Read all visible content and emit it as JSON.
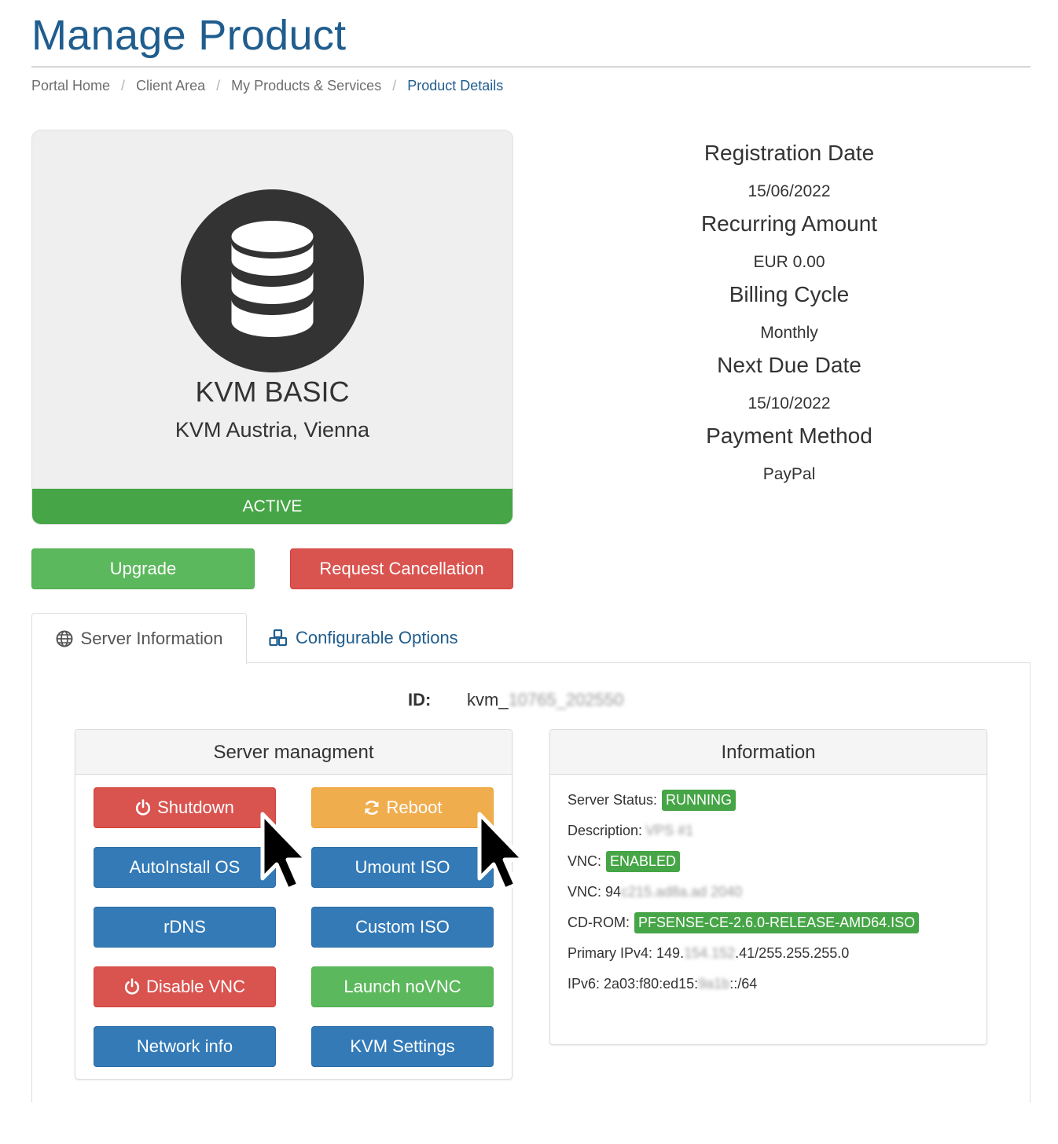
{
  "page": {
    "title": "Manage Product"
  },
  "breadcrumb": [
    {
      "label": "Portal Home"
    },
    {
      "label": "Client Area"
    },
    {
      "label": "My Products & Services"
    },
    {
      "label": "Product Details"
    }
  ],
  "breadcrumb_separator": "/",
  "product": {
    "icon": "database-icon",
    "name": "KVM BASIC",
    "location": "KVM Austria, Vienna",
    "status": "ACTIVE"
  },
  "actions": {
    "upgrade": "Upgrade",
    "cancel": "Request Cancellation"
  },
  "details": [
    {
      "label": "Registration Date",
      "value": "15/06/2022"
    },
    {
      "label": "Recurring Amount",
      "value": "EUR 0.00"
    },
    {
      "label": "Billing Cycle",
      "value": "Monthly"
    },
    {
      "label": "Next Due Date",
      "value": "15/10/2022"
    },
    {
      "label": "Payment Method",
      "value": "PayPal"
    }
  ],
  "tabs": {
    "server_info": "Server Information",
    "configurable_options": "Configurable Options"
  },
  "server": {
    "id_label": "ID:",
    "id_prefix": "kvm_",
    "id_redacted": "10765_202550"
  },
  "management": {
    "heading": "Server managment",
    "buttons": {
      "shutdown": "Shutdown",
      "reboot": "Reboot",
      "autoinstall": "AutoInstall OS",
      "umount_iso": "Umount ISO",
      "rdns": "rDNS",
      "custom_iso": "Custom ISO",
      "disable_vnc": "Disable VNC",
      "launch_novnc": "Launch noVNC",
      "network_info": "Network info",
      "kvm_settings": "KVM Settings"
    }
  },
  "information": {
    "heading": "Information",
    "server_status_label": "Server Status:",
    "server_status": "RUNNING",
    "description_label": "Description:",
    "description_redacted": "VPS #1",
    "vnc_label": "VNC:",
    "vnc_status": "ENABLED",
    "vnc_addr_label": "VNC:",
    "vnc_addr_prefix": "94",
    "vnc_addr_redacted": "c215.ad8a.ad 2040",
    "cdrom_label": "CD-ROM:",
    "cdrom_value": "PFSENSE-CE-2.6.0-RELEASE-AMD64.ISO",
    "ipv4_label": "Primary IPv4:",
    "ipv4_prefix": "149.",
    "ipv4_redacted": "154.152",
    "ipv4_suffix": ".41/255.255.255.0",
    "ipv6_label": "IPv6:",
    "ipv6_prefix": "2a03:f80:ed15:",
    "ipv6_redacted": "9a1b",
    "ipv6_suffix": "::/64"
  },
  "colors": {
    "brand_blue": "#1f5d8e",
    "active_green": "#46a546",
    "btn_green": "#5cb85c",
    "btn_red": "#d9534f",
    "btn_orange": "#f0ad4e",
    "btn_blue": "#337ab7"
  }
}
